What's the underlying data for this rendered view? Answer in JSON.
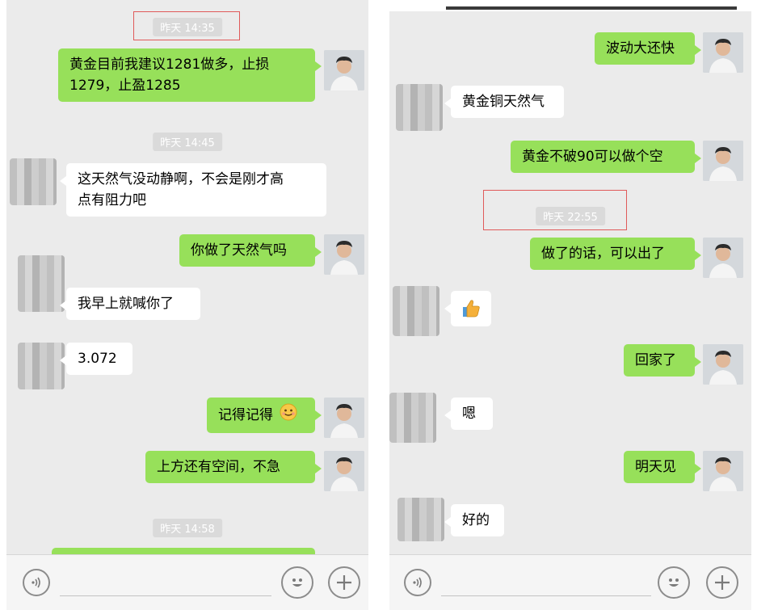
{
  "left_panel": {
    "timestamps": [
      "昨天 14:35",
      "昨天 14:45",
      "昨天 14:58"
    ],
    "messages": [
      {
        "side": "me",
        "line1": "黄金目前我建议1281做多，止损",
        "line2": "1279，止盈1285"
      },
      {
        "side": "them",
        "line1": "这天然气没动静啊，不会是刚才高",
        "line2": "点有阻力吧"
      },
      {
        "side": "me",
        "text": "你做了天然气吗"
      },
      {
        "side": "them",
        "text": "我早上就喊你了"
      },
      {
        "side": "them",
        "text": "3.072"
      },
      {
        "side": "me",
        "text": "记得记得"
      },
      {
        "side": "me",
        "text": "上方还有空间，不急"
      }
    ]
  },
  "right_panel": {
    "timestamps": [
      "昨天 22:55"
    ],
    "messages": [
      {
        "side": "me",
        "text": "波动大还快"
      },
      {
        "side": "them",
        "text": "黄金铜天然气"
      },
      {
        "side": "me",
        "text": "黄金不破90可以做个空"
      },
      {
        "side": "me",
        "text": "做了的话，可以出了"
      },
      {
        "side": "them",
        "text": ""
      },
      {
        "side": "me",
        "text": "回家了"
      },
      {
        "side": "them",
        "text": "嗯"
      },
      {
        "side": "me",
        "text": "明天见"
      },
      {
        "side": "them",
        "text": "好的"
      }
    ]
  },
  "icons": {
    "voice": "voice-icon",
    "emoji": "emoji-icon",
    "plus": "plus-icon",
    "thumbs": "thumbs-up-icon",
    "smile": "smiling-face-emoji"
  },
  "colors": {
    "me_bubble": "#97e05a",
    "them_bubble": "#ffffff",
    "chat_bg": "#ebebeb",
    "highlight_box": "#e05a5a"
  }
}
